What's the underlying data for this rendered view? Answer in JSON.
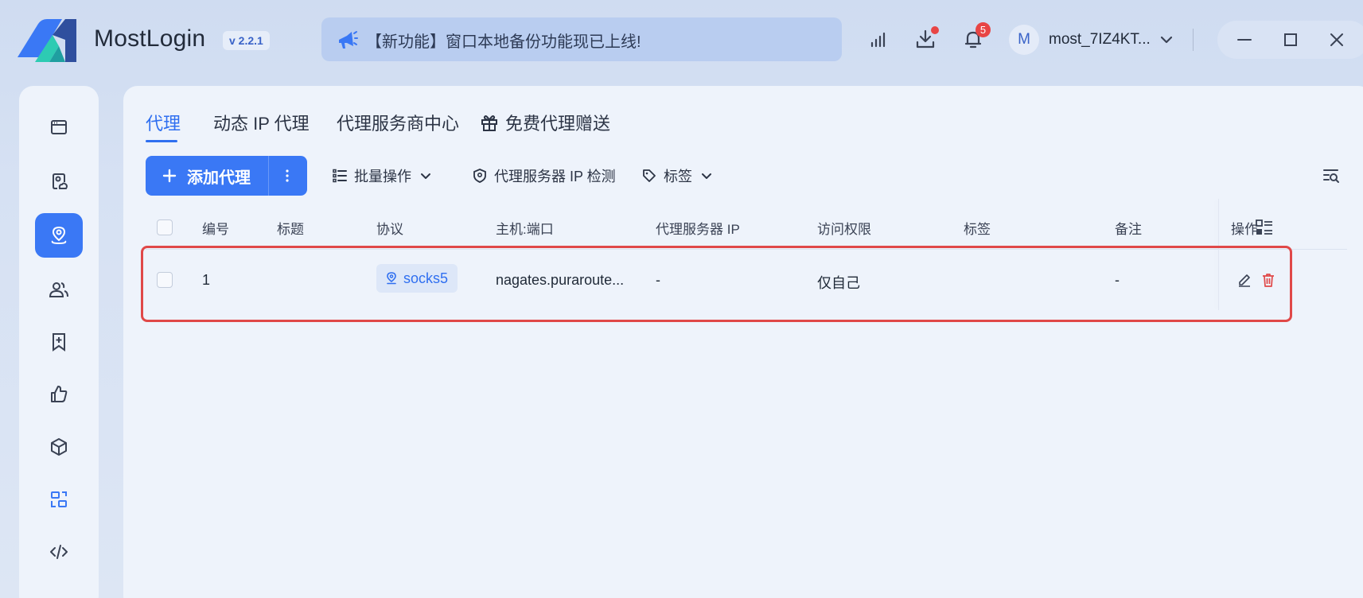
{
  "app": {
    "name": "MostLogin",
    "version": "v 2.2.1",
    "announcement": "【新功能】窗口本地备份功能现已上线!",
    "notifications_count": "5",
    "user": {
      "avatar_letter": "M",
      "name": "most_7IZ4KT..."
    },
    "accent_color": "#3a78f5",
    "alert_color": "#e84545"
  },
  "titlebar_icons": [
    "signal-icon",
    "download-icon",
    "bell-icon",
    "chevron-down-icon",
    "minimize-icon",
    "maximize-icon",
    "close-icon"
  ],
  "sidebar": {
    "items": [
      {
        "icon": "browser-window-icon",
        "active": false
      },
      {
        "icon": "profile-cloud-icon",
        "active": false
      },
      {
        "icon": "location-pin-icon",
        "active": true
      },
      {
        "icon": "users-icon",
        "active": false
      },
      {
        "icon": "bookmark-add-icon",
        "active": false
      },
      {
        "icon": "thumbs-up-icon",
        "active": false
      },
      {
        "icon": "cube-icon",
        "active": false
      },
      {
        "icon": "layout-switch-icon",
        "active": false
      },
      {
        "icon": "code-icon",
        "active": false
      }
    ]
  },
  "tabs": [
    {
      "label": "代理",
      "active": true
    },
    {
      "label": "动态 IP 代理",
      "active": false
    },
    {
      "label": "代理服务商中心",
      "active": false
    },
    {
      "label": "免费代理赠送",
      "active": false
    }
  ],
  "toolbar": {
    "add_label": "添加代理",
    "batch_label": "批量操作",
    "ip_check_label": "代理服务器 IP 检测",
    "tags_label": "标签"
  },
  "table": {
    "columns": [
      "编号",
      "标题",
      "协议",
      "主机:端口",
      "代理服务器 IP",
      "访问权限",
      "标签",
      "备注",
      "操作"
    ],
    "rows": [
      {
        "id": "1",
        "title": "",
        "protocol": "socks5",
        "host_port": "nagates.puraroute...",
        "server_ip": "-",
        "access": "仅自己",
        "tags": "",
        "note": "-"
      }
    ]
  }
}
